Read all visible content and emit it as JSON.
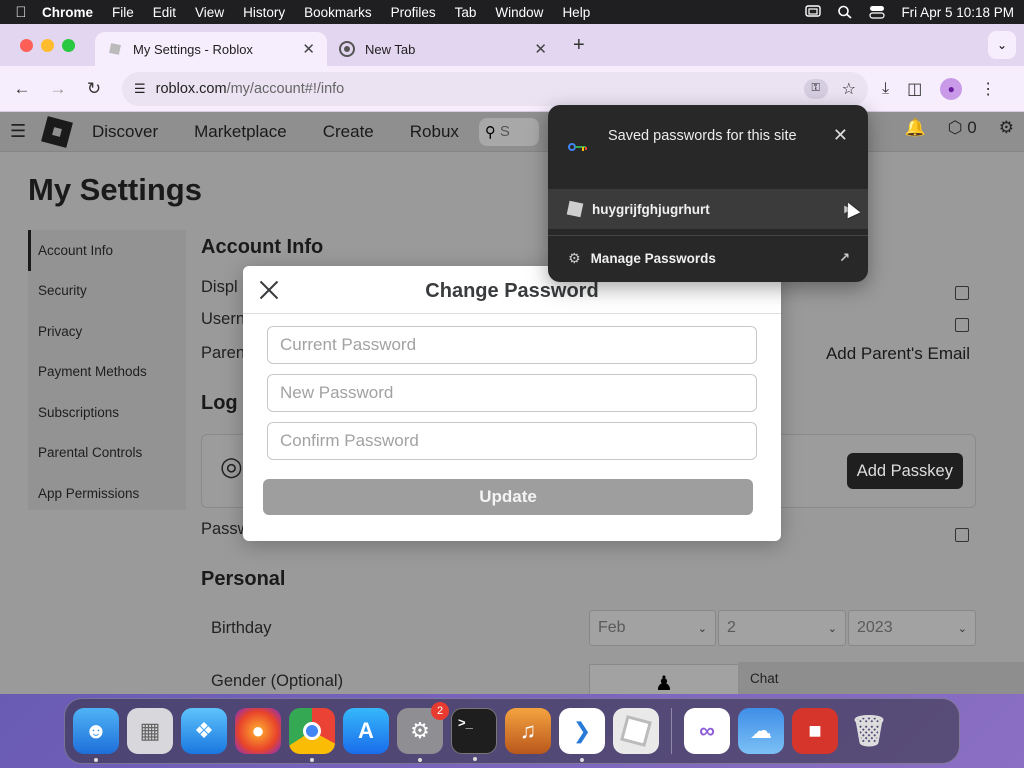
{
  "menubar": {
    "app": "Chrome",
    "items": [
      "File",
      "Edit",
      "View",
      "History",
      "Bookmarks",
      "Profiles",
      "Tab",
      "Window",
      "Help"
    ],
    "datetime": "Fri Apr 5  10:18 PM"
  },
  "tabs": [
    {
      "title": "My Settings - Roblox",
      "active": true
    },
    {
      "title": "New Tab",
      "active": false
    }
  ],
  "toolbar": {
    "url_host": "roblox.com",
    "url_path": "/my/account#!/info"
  },
  "roblox_nav": {
    "links": [
      "Discover",
      "Marketplace",
      "Create",
      "Robux"
    ],
    "search_placeholder": "S",
    "robux_count": "0"
  },
  "settings": {
    "title": "My Settings",
    "nav": [
      "Account Info",
      "Security",
      "Privacy",
      "Payment Methods",
      "Subscriptions",
      "Parental Controls",
      "App Permissions"
    ],
    "account_info_heading": "Account Info",
    "row_display": "Displ",
    "row_username": "Usern",
    "row_parent": "Paren",
    "add_parent_email": "Add Parent's Email",
    "login_heading": "Log",
    "add_passkey": "Add Passkey",
    "row_password": "Passw",
    "personal_heading": "Personal",
    "birthday_label": "Birthday",
    "birthday": {
      "month": "Feb",
      "day": "2",
      "year": "2023"
    },
    "gender_label": "Gender (Optional)",
    "chat": "Chat"
  },
  "modal": {
    "title": "Change Password",
    "current_placeholder": "Current Password",
    "new_placeholder": "New Password",
    "confirm_placeholder": "Confirm Password",
    "update_label": "Update"
  },
  "password_popup": {
    "title": "Saved passwords for this site",
    "username": "huygrijfghjugrhurt",
    "manage": "Manage Passwords"
  },
  "dock": {
    "apps": [
      "finder-icon",
      "launchpad-icon",
      "safari-icon",
      "firefox-icon",
      "chrome-icon",
      "app-store-icon",
      "system-settings-icon",
      "terminal-icon",
      "garageband-icon",
      "vscode-icon",
      "roblox-icon",
      "visual-studio-icon",
      "weather-icon",
      "photo-booth-icon",
      "trash-icon"
    ],
    "settings_badge": "2"
  },
  "colors": {
    "popup_bg": "#282828",
    "modal_button_disabled": "#9e9e9e",
    "tab_strip": "#e3d6f0"
  }
}
